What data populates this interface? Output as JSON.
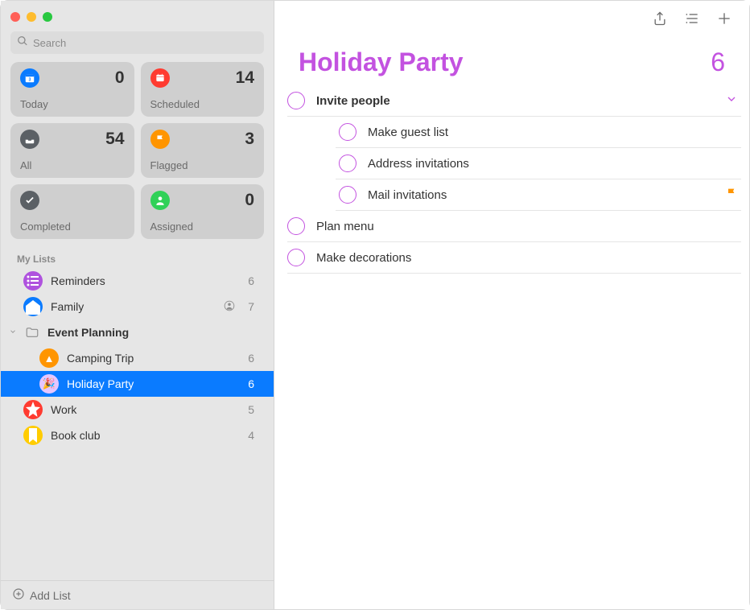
{
  "accent_color": "#c352e0",
  "search": {
    "placeholder": "Search"
  },
  "smart_cards": {
    "today": {
      "label": "Today",
      "count": 0
    },
    "scheduled": {
      "label": "Scheduled",
      "count": 14
    },
    "all": {
      "label": "All",
      "count": 54
    },
    "flagged": {
      "label": "Flagged",
      "count": 3
    },
    "completed": {
      "label": "Completed",
      "count": ""
    },
    "assigned": {
      "label": "Assigned",
      "count": 0
    }
  },
  "lists_heading": "My Lists",
  "lists": {
    "reminders": {
      "label": "Reminders",
      "count": 6,
      "shared": false
    },
    "family": {
      "label": "Family",
      "count": 7,
      "shared": true
    },
    "group": {
      "label": "Event Planning"
    },
    "camping": {
      "label": "Camping Trip",
      "count": 6
    },
    "holiday": {
      "label": "Holiday Party",
      "count": 6
    },
    "work": {
      "label": "Work",
      "count": 5
    },
    "bookclub": {
      "label": "Book club",
      "count": 4
    }
  },
  "add_list_label": "Add List",
  "current_list": {
    "title": "Holiday Party",
    "total": 6
  },
  "reminders": [
    {
      "text": "Invite people",
      "parent": true,
      "expand": true
    },
    {
      "text": "Make guest list",
      "sub": true
    },
    {
      "text": "Address invitations",
      "sub": true
    },
    {
      "text": "Mail invitations",
      "sub": true,
      "flagged": true
    },
    {
      "text": "Plan menu"
    },
    {
      "text": "Make decorations"
    }
  ]
}
